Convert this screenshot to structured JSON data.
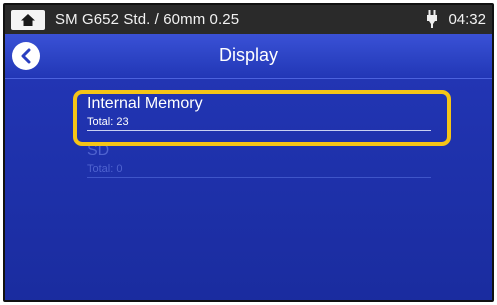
{
  "statusbar": {
    "home_icon": "home-icon",
    "title": "SM G652 Std. / 60mm 0.25",
    "power_icon": "plug-icon",
    "clock": "04:32"
  },
  "header": {
    "back_icon": "chevron-left-icon",
    "title": "Display"
  },
  "storage_items": [
    {
      "label": "Internal Memory",
      "total": "Total: 23",
      "selected": true
    },
    {
      "label": "SD",
      "total": "Total: 0",
      "selected": false
    }
  ],
  "colors": {
    "background": "#1b2fa8",
    "statusbar": "#2a2a2a",
    "highlight": "#f5c417"
  }
}
